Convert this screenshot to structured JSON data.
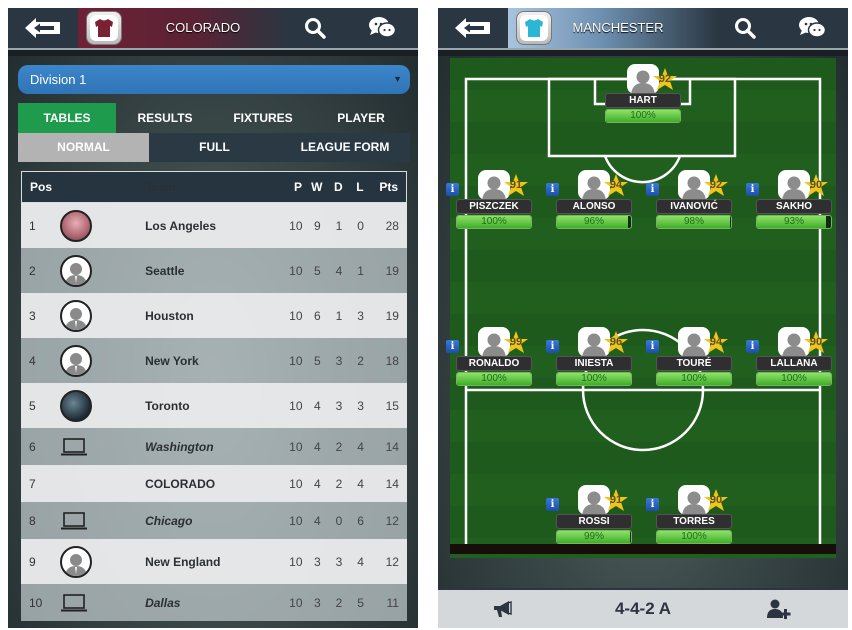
{
  "left_screen": {
    "header": {
      "team_name": "COLORADO",
      "shirt_color": "#7b2232"
    },
    "division": {
      "selected": "Division 1"
    },
    "tabs": [
      {
        "label": "TABLES",
        "active": true
      },
      {
        "label": "RESULTS",
        "active": false
      },
      {
        "label": "FIXTURES",
        "active": false
      },
      {
        "label": "PLAYER",
        "active": false
      }
    ],
    "subtabs": [
      {
        "label": "NORMAL",
        "active": true
      },
      {
        "label": "FULL",
        "active": false
      },
      {
        "label": "LEAGUE FORM",
        "active": false
      }
    ],
    "table": {
      "headers": {
        "pos": "Pos",
        "team": "Team",
        "p": "P",
        "w": "W",
        "d": "D",
        "l": "L",
        "pts": "Pts"
      },
      "rows": [
        {
          "pos": "1",
          "crest": "photo",
          "team": "Los Angeles",
          "p": "10",
          "w": "9",
          "d": "1",
          "l": "0",
          "pts": "28",
          "italic": false
        },
        {
          "pos": "2",
          "crest": "user-silhouette",
          "team": "Seattle",
          "p": "10",
          "w": "5",
          "d": "4",
          "l": "1",
          "pts": "19",
          "italic": false
        },
        {
          "pos": "3",
          "crest": "user-silhouette",
          "team": "Houston",
          "p": "10",
          "w": "6",
          "d": "1",
          "l": "3",
          "pts": "19",
          "italic": false
        },
        {
          "pos": "4",
          "crest": "user-silhouette",
          "team": "New York",
          "p": "10",
          "w": "5",
          "d": "3",
          "l": "2",
          "pts": "18",
          "italic": false
        },
        {
          "pos": "5",
          "crest": "photo",
          "team": "Toronto",
          "p": "10",
          "w": "4",
          "d": "3",
          "l": "3",
          "pts": "15",
          "italic": false
        },
        {
          "pos": "6",
          "crest": "laptop",
          "team": "Washington",
          "p": "10",
          "w": "4",
          "d": "2",
          "l": "4",
          "pts": "14",
          "italic": true
        },
        {
          "pos": "7",
          "crest": "none",
          "team": "COLORADO",
          "p": "10",
          "w": "4",
          "d": "2",
          "l": "4",
          "pts": "14",
          "italic": false
        },
        {
          "pos": "8",
          "crest": "laptop",
          "team": "Chicago",
          "p": "10",
          "w": "4",
          "d": "0",
          "l": "6",
          "pts": "12",
          "italic": true
        },
        {
          "pos": "9",
          "crest": "user-silhouette",
          "team": "New England",
          "p": "10",
          "w": "3",
          "d": "3",
          "l": "4",
          "pts": "12",
          "italic": false
        },
        {
          "pos": "10",
          "crest": "laptop",
          "team": "Dallas",
          "p": "10",
          "w": "3",
          "d": "2",
          "l": "5",
          "pts": "11",
          "italic": true
        }
      ]
    }
  },
  "right_screen": {
    "header": {
      "team_name": "MANCHESTER",
      "shirt_color": "#2bb6d6"
    },
    "players": [
      {
        "name": "HART",
        "rating": "92",
        "fitness": 100,
        "fitness_label": "100%",
        "info": false
      },
      {
        "name": "PISZCZEK",
        "rating": "91",
        "fitness": 100,
        "fitness_label": "100%",
        "info": true
      },
      {
        "name": "ALONSO",
        "rating": "94",
        "fitness": 96,
        "fitness_label": "96%",
        "info": true
      },
      {
        "name": "IVANOVIĆ",
        "rating": "92",
        "fitness": 98,
        "fitness_label": "98%",
        "info": true
      },
      {
        "name": "SAKHO",
        "rating": "90",
        "fitness": 93,
        "fitness_label": "93%",
        "info": true
      },
      {
        "name": "RONALDO",
        "rating": "99",
        "fitness": 100,
        "fitness_label": "100%",
        "info": true
      },
      {
        "name": "INIESTA",
        "rating": "96",
        "fitness": 100,
        "fitness_label": "100%",
        "info": true
      },
      {
        "name": "TOURÉ",
        "rating": "94",
        "fitness": 100,
        "fitness_label": "100%",
        "info": true
      },
      {
        "name": "LALLANA",
        "rating": "90",
        "fitness": 100,
        "fitness_label": "100%",
        "info": true
      },
      {
        "name": "ROSSI",
        "rating": "91",
        "fitness": 99,
        "fitness_label": "99%",
        "info": true
      },
      {
        "name": "TORRES",
        "rating": "90",
        "fitness": 100,
        "fitness_label": "100%",
        "info": true
      }
    ],
    "info_glyph": "i",
    "bottom_bar": {
      "formation": "4-4-2 A"
    }
  },
  "icons": {
    "back": "back-arrow-icon",
    "search": "search-icon",
    "chat": "chat-bubbles-icon",
    "megaphone": "megaphone-icon",
    "add_user": "add-user-icon"
  }
}
